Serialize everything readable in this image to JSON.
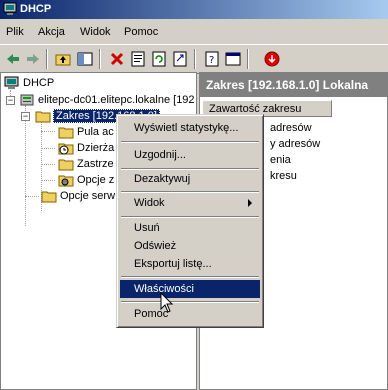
{
  "window": {
    "title": "DHCP"
  },
  "menubar": {
    "items": [
      "Plik",
      "Akcja",
      "Widok",
      "Pomoc"
    ]
  },
  "toolbar": {
    "buttons": [
      "back-icon",
      "forward-icon",
      "up-folder-icon",
      "show-hide-tree-icon",
      "delete-icon",
      "properties-icon",
      "refresh-icon",
      "export-list-icon",
      "help-icon",
      "console-icon",
      "stop-icon"
    ]
  },
  "tree": {
    "root": "DHCP",
    "server": "elitepc-dc01.elitepc.lokalne [192",
    "scope": "Zakres [192.168.1.0]",
    "children": [
      "Pula ac",
      "Dzierża",
      "Zastrze",
      "Opcje z"
    ],
    "server_options": "Opcje serw"
  },
  "right": {
    "header": "Zakres [192.168.1.0] Lokalna",
    "column": "Zawartość zakresu",
    "rows": [
      "adresów",
      "y adresów",
      "enia",
      "kresu"
    ]
  },
  "context_menu": {
    "items": [
      {
        "label": "Wyświetl statystykę...",
        "highlighted": false
      },
      {
        "label": "Uzgodnij...",
        "highlighted": false
      },
      {
        "label": "Dezaktywuj",
        "highlighted": false
      },
      {
        "label": "Widok",
        "submenu": true,
        "highlighted": false
      },
      {
        "label": "Usuń",
        "highlighted": false
      },
      {
        "label": "Odśwież",
        "highlighted": false
      },
      {
        "label": "Eksportuj listę...",
        "highlighted": false
      },
      {
        "label": "Właściwości",
        "highlighted": true
      },
      {
        "label": "Pomoc",
        "highlighted": false
      }
    ]
  },
  "colors": {
    "highlight": "#0a246a",
    "face": "#d4d0c8",
    "title_gradient_end": "#a6caf0"
  }
}
